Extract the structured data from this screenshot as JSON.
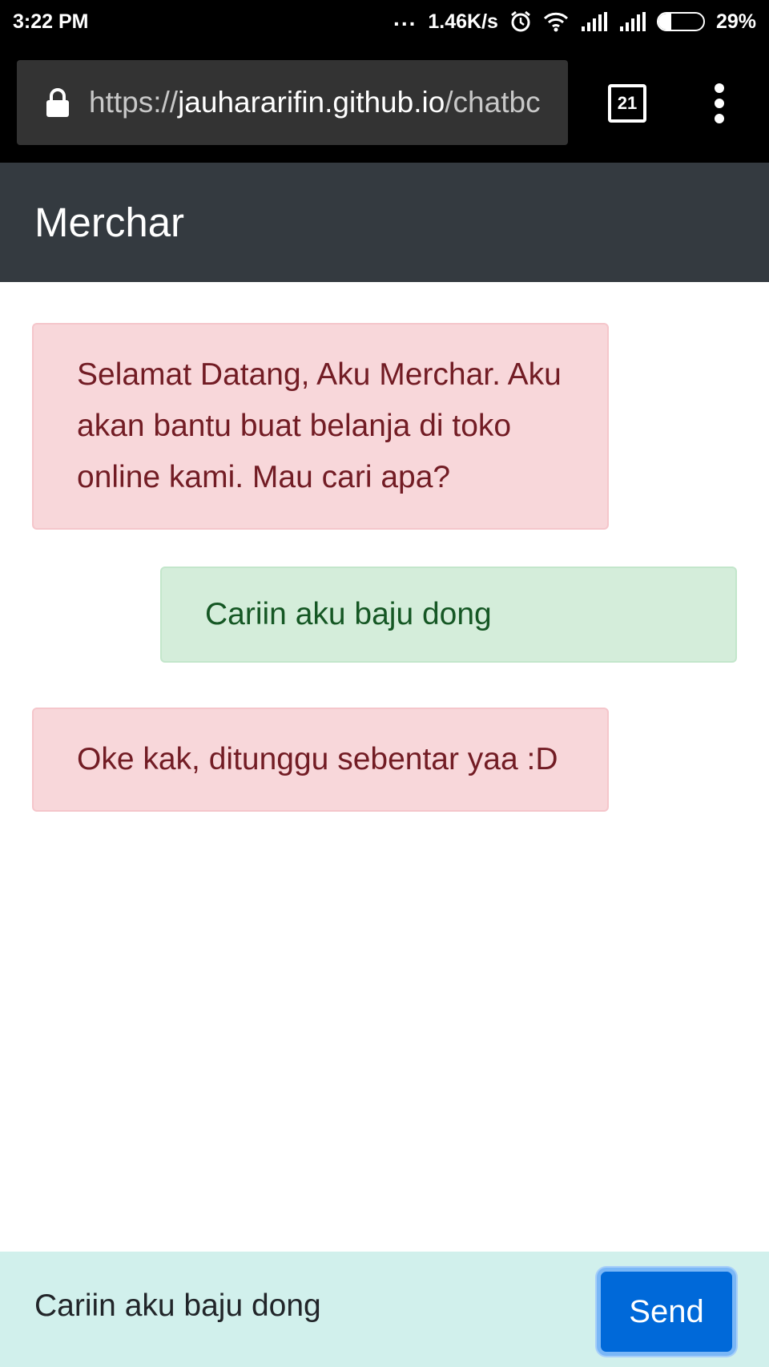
{
  "status_bar": {
    "time": "3:22 PM",
    "dots": "...",
    "net_speed": "1.46K/s",
    "battery_percent": "29%",
    "battery_level": 0.29
  },
  "browser": {
    "url_scheme": "https://",
    "url_host": "jauhararifin.github.io",
    "url_path": "/chatbc",
    "tab_count": "21"
  },
  "app": {
    "brand": "Merchar"
  },
  "messages": [
    {
      "sender": "bot",
      "text": "Selamat Datang, Aku Merchar. Aku akan bantu buat belanja di toko online kami. Mau cari apa?"
    },
    {
      "sender": "user",
      "text": "Cariin aku baju dong"
    },
    {
      "sender": "bot",
      "text": "Oke kak, ditunggu sebentar yaa :D"
    }
  ],
  "composer": {
    "input_value": "Cariin aku baju dong",
    "send_label": "Send"
  },
  "colors": {
    "navbar": "#343a40",
    "bot_bubble": "#f8d7da",
    "user_bubble": "#d4edda",
    "footer": "#d1f0ec",
    "send_button": "#0069d9"
  }
}
